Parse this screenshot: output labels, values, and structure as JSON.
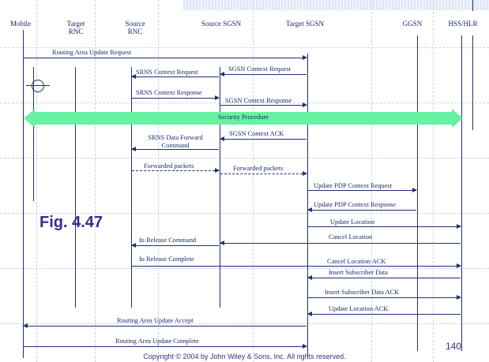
{
  "entities": {
    "mobile": "Mobile",
    "target_rnc": [
      "Target",
      "RNC"
    ],
    "source_rnc": [
      "Source",
      "RNC"
    ],
    "source_sgsn": "Source SGSN",
    "target_sgsn": "Target SGSN",
    "ggsn": "GGSN",
    "hss_hlr": "HSS/HLR"
  },
  "messages": [
    "Routing Area Update Request",
    "SGSN Context Request",
    "SRNS Context Request",
    "SRNS Context Response",
    "SGSN Context Response",
    "SGSN Context ACK",
    [
      "SRNS Data Forward",
      "Command"
    ],
    "Forwarded packets",
    "Forwarded packets",
    "Update PDP Context Request",
    "Update PDP Context Response",
    "Update Location",
    "Cancel Location",
    "Iu Release Command",
    "Iu Release Complete",
    "Cancel Location ACK",
    "Insert Subscriber Data",
    "Insert Subscriber Data ACK",
    "Update Location ACK",
    "Routing Area Update Accept",
    "Routing Area Update Complete"
  ],
  "security_procedure": "Security Procedure",
  "figure_label": "Fig. 4.47",
  "page_number": "140",
  "copyright": "Copyright © 2004 by John Wiley & Sons, Inc. All rights reserved.",
  "colors": {
    "line": "#203070",
    "text": "#1a2a6c",
    "security_band": "#66f2a0",
    "caption": "#3a2a8c"
  }
}
